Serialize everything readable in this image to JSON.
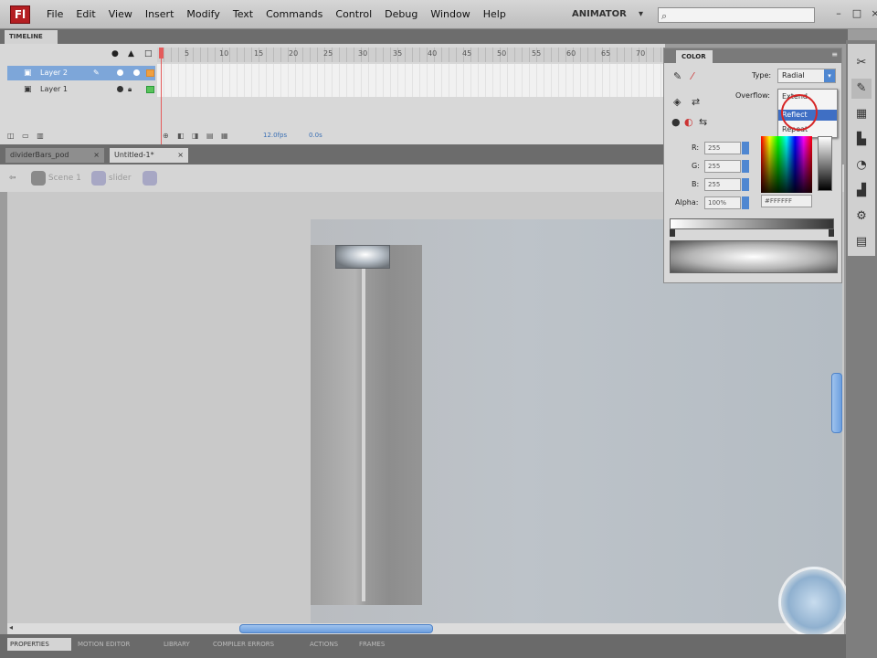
{
  "menubar": {
    "logo": "Fl",
    "menus": [
      "File",
      "Edit",
      "View",
      "Insert",
      "Modify",
      "Text",
      "Commands",
      "Control",
      "Debug",
      "Window",
      "Help"
    ],
    "workspace": "ANIMATOR",
    "search_placeholder": ""
  },
  "timeline": {
    "tab_label": "TIMELINE",
    "layers": [
      {
        "name": "Layer 2",
        "selected": true
      },
      {
        "name": "Layer 1",
        "selected": false
      }
    ],
    "frame_numbers": [
      "5",
      "10",
      "15",
      "20",
      "25",
      "30",
      "35",
      "40",
      "45",
      "50",
      "55",
      "60",
      "65",
      "70"
    ],
    "fps": "12.0fps",
    "time": "0.0s"
  },
  "documents": {
    "tabs": [
      {
        "label": "dividerBars_pod"
      },
      {
        "label": "Untitled-1*"
      }
    ]
  },
  "edit_bar": {
    "scene_label": "Scene 1",
    "symbol_label": "slider"
  },
  "bottom_tabs": [
    "PROPERTIES",
    "MOTION EDITOR",
    "LIBRARY",
    "COMPILER ERRORS",
    "ACTIONS",
    "FRAMES"
  ],
  "color_panel": {
    "tab_label": "COLOR",
    "type_label": "Type:",
    "type_value": "Radial",
    "overflow_label": "Overflow:",
    "overflow_options": [
      "Extend",
      "Reflect",
      "Repeat"
    ],
    "r_label": "R:",
    "r_value": "255",
    "g_label": "G:",
    "g_value": "255",
    "b_label": "B:",
    "b_value": "255",
    "alpha_label": "Alpha:",
    "alpha_value": "100%",
    "hex_value": "#FFFFFF"
  },
  "icons": {
    "close": "×",
    "menu": "≡",
    "caret": "▾"
  }
}
